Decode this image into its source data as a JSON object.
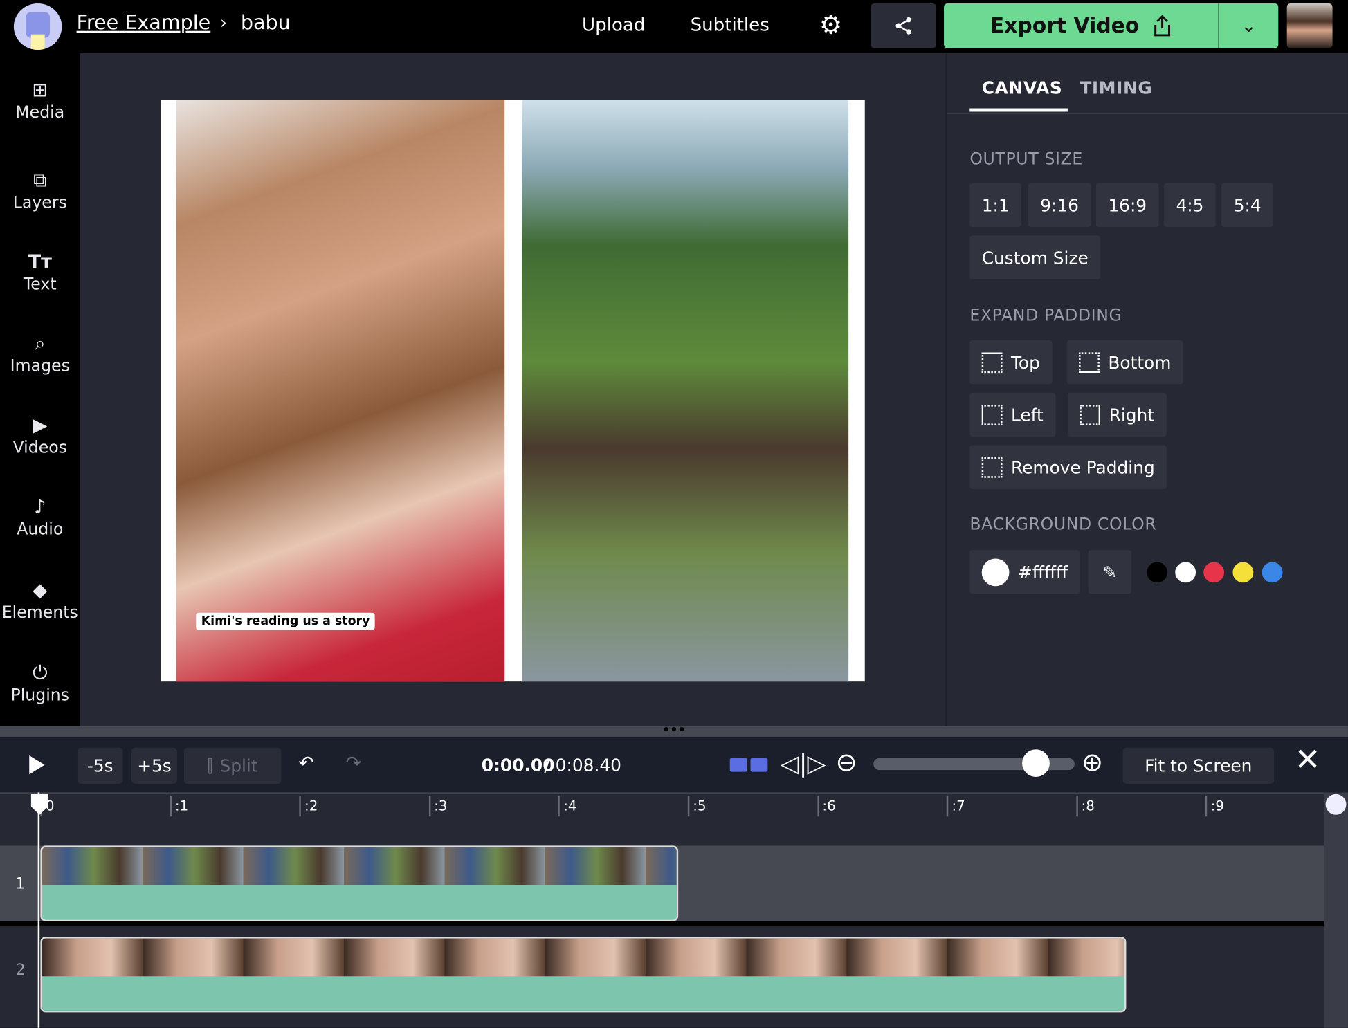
{
  "header": {
    "project": "Free Example",
    "separator": "›",
    "page": "babu",
    "upload": "Upload",
    "subtitles": "Subtitles",
    "export": "Export Video",
    "icons": [
      "gear-icon",
      "share-icon",
      "upload-icon",
      "chevron-down-icon"
    ]
  },
  "sidebar": {
    "items": [
      {
        "label": "Media",
        "icon": "⊞"
      },
      {
        "label": "Layers",
        "icon": "⧉"
      },
      {
        "label": "Text",
        "icon": "Tт"
      },
      {
        "label": "Images",
        "icon": "⌕"
      },
      {
        "label": "Videos",
        "icon": "▶"
      },
      {
        "label": "Audio",
        "icon": "♪"
      },
      {
        "label": "Elements",
        "icon": "◆"
      },
      {
        "label": "Plugins",
        "icon": "⏻"
      }
    ]
  },
  "canvas": {
    "caption": "Kimi's reading us a story"
  },
  "panel": {
    "tabs": [
      "CANVAS",
      "TIMING"
    ],
    "output_size_title": "OUTPUT SIZE",
    "sizes": [
      "1:1",
      "9:16",
      "16:9",
      "4:5",
      "5:4"
    ],
    "custom": "Custom Size",
    "padding_title": "EXPAND PADDING",
    "padding": [
      "Top",
      "Bottom",
      "Left",
      "Right",
      "Remove Padding"
    ],
    "bg_title": "BACKGROUND COLOR",
    "bg_value": "#ffffff",
    "swatches": [
      "#000000",
      "#ffffff",
      "#e8344a",
      "#f5e03a",
      "#3b87e8"
    ]
  },
  "timeline": {
    "minus": "-5s",
    "plus": "+5s",
    "split": "Split",
    "current": "0:00.00",
    "total": " / 0:08.40",
    "fit": "Fit to Screen",
    "zoom_level": 0.8,
    "ticks": [
      "0",
      ":1",
      ":2",
      ":3",
      ":4",
      ":5",
      ":6",
      ":7",
      ":8",
      ":9"
    ],
    "tracks": [
      "1",
      "2"
    ]
  },
  "colors": {
    "accent": "#6dd993",
    "snap": "#5b6ee1"
  }
}
